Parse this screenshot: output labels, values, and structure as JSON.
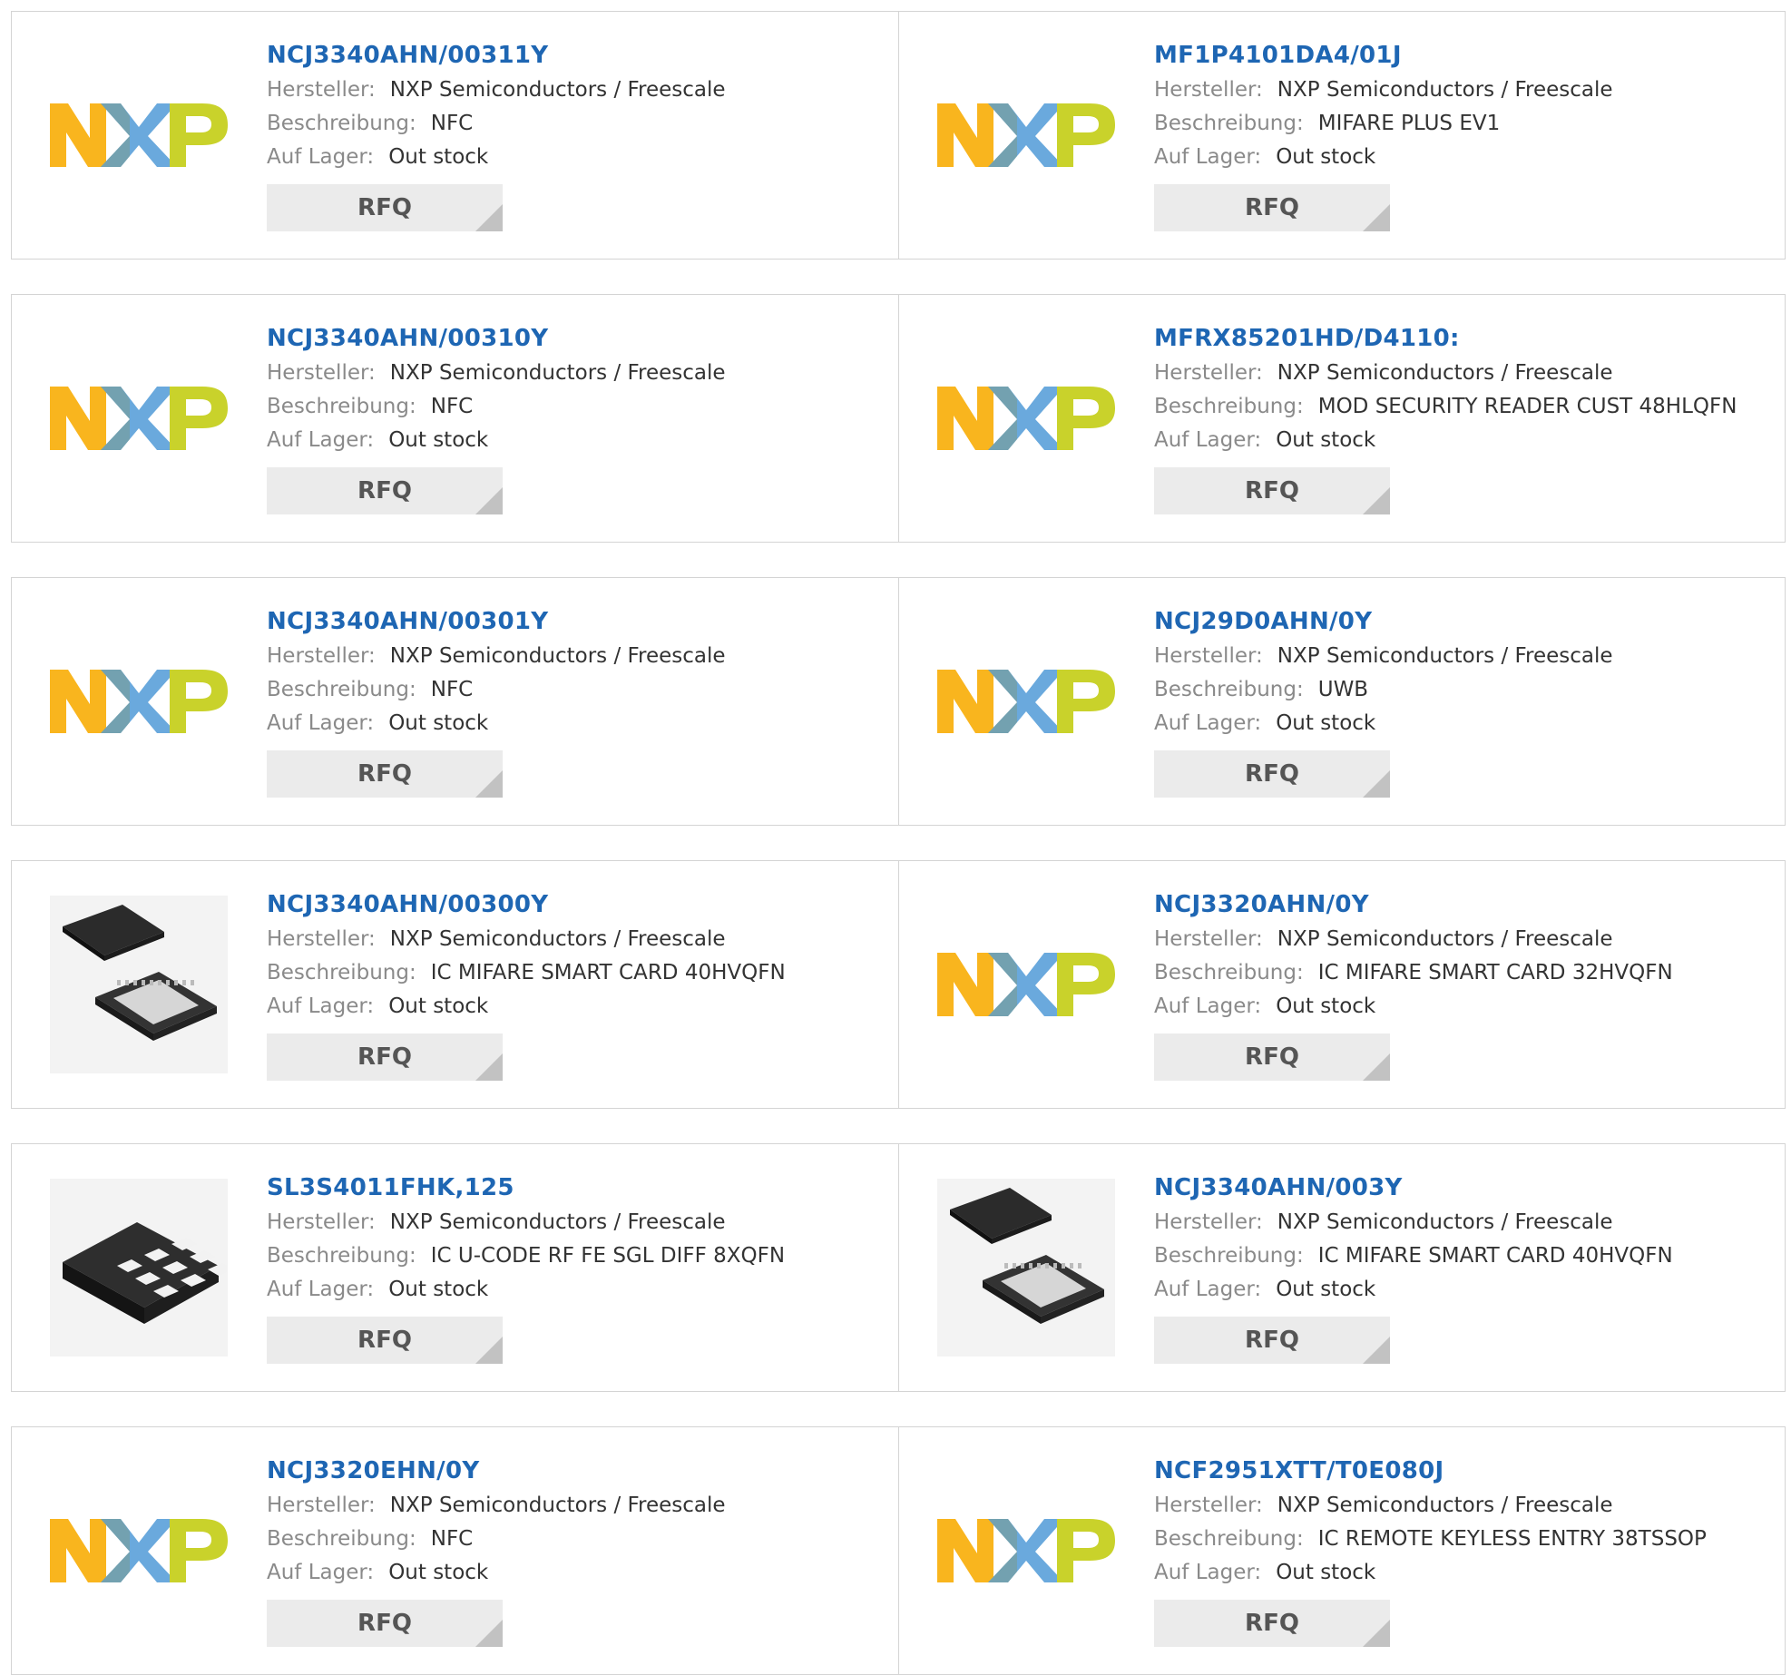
{
  "labels": {
    "manufacturer": "Hersteller:",
    "description": "Beschreibung:",
    "stock": "Auf Lager:",
    "rfq": "RFQ"
  },
  "colors": {
    "link": "#1e66b3",
    "nxp_yellow": "#f9b51e",
    "nxp_blue": "#6aa9dd",
    "nxp_green": "#c9d22b"
  },
  "products": [
    {
      "part": "NCJ3340AHN/00311Y",
      "manufacturer": "NXP Semiconductors / Freescale",
      "description": "NFC",
      "stock": "Out stock",
      "image": "nxp-logo"
    },
    {
      "part": "MF1P4101DA4/01J",
      "manufacturer": "NXP Semiconductors / Freescale",
      "description": "MIFARE PLUS EV1",
      "stock": "Out stock",
      "image": "nxp-logo"
    },
    {
      "part": "NCJ3340AHN/00310Y",
      "manufacturer": "NXP Semiconductors / Freescale",
      "description": "NFC",
      "stock": "Out stock",
      "image": "nxp-logo"
    },
    {
      "part": "MFRX85201HD/D4110:",
      "manufacturer": "NXP Semiconductors / Freescale",
      "description": "MOD SECURITY READER CUST 48HLQFN",
      "stock": "Out stock",
      "image": "nxp-logo"
    },
    {
      "part": "NCJ3340AHN/00301Y",
      "manufacturer": "NXP Semiconductors / Freescale",
      "description": "NFC",
      "stock": "Out stock",
      "image": "nxp-logo"
    },
    {
      "part": "NCJ29D0AHN/0Y",
      "manufacturer": "NXP Semiconductors / Freescale",
      "description": "UWB",
      "stock": "Out stock",
      "image": "nxp-logo"
    },
    {
      "part": "NCJ3340AHN/00300Y",
      "manufacturer": "NXP Semiconductors / Freescale",
      "description": "IC MIFARE SMART CARD 40HVQFN",
      "stock": "Out stock",
      "image": "qfn-chip"
    },
    {
      "part": "NCJ3320AHN/0Y",
      "manufacturer": "NXP Semiconductors / Freescale",
      "description": "IC MIFARE SMART CARD 32HVQFN",
      "stock": "Out stock",
      "image": "nxp-logo"
    },
    {
      "part": "SL3S4011FHK,125",
      "manufacturer": "NXP Semiconductors / Freescale",
      "description": "IC U-CODE RF FE SGL DIFF 8XQFN",
      "stock": "Out stock",
      "image": "xqfn-chip"
    },
    {
      "part": "NCJ3340AHN/003Y",
      "manufacturer": "NXP Semiconductors / Freescale",
      "description": "IC MIFARE SMART CARD 40HVQFN",
      "stock": "Out stock",
      "image": "qfn-chip"
    },
    {
      "part": "NCJ3320EHN/0Y",
      "manufacturer": "NXP Semiconductors / Freescale",
      "description": "NFC",
      "stock": "Out stock",
      "image": "nxp-logo"
    },
    {
      "part": "NCF2951XTT/T0E080J",
      "manufacturer": "NXP Semiconductors / Freescale",
      "description": "IC REMOTE KEYLESS ENTRY 38TSSOP",
      "stock": "Out stock",
      "image": "nxp-logo"
    }
  ]
}
